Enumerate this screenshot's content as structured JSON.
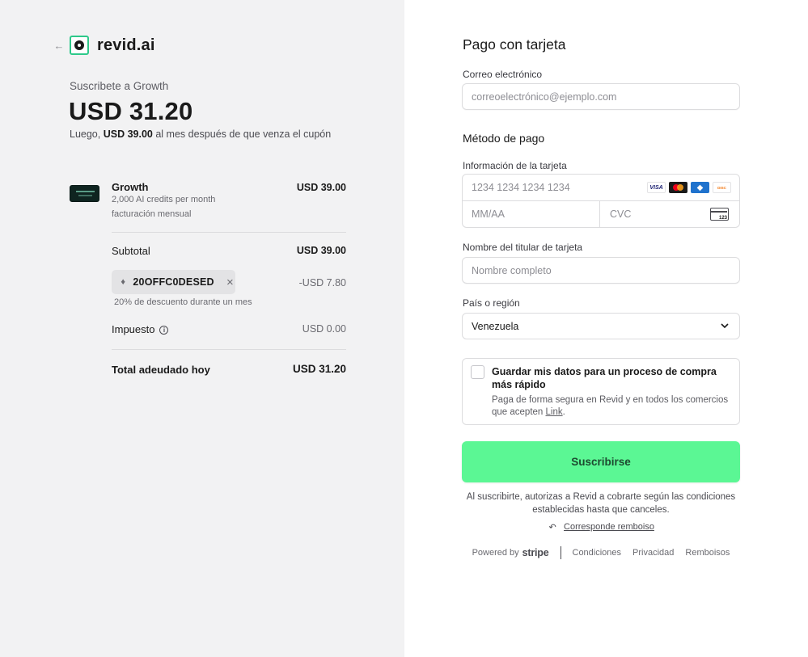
{
  "brand": {
    "name": "revid.ai",
    "back_icon": "arrow-left-icon",
    "logo_icon": "eye-logo-icon",
    "accent": "#2ec98a"
  },
  "summary": {
    "subscribe_label": "Suscribete a Growth",
    "amount": "USD 31.20",
    "later_prefix": "Luego,",
    "later_amount": "USD 39.00",
    "later_suffix": "al mes después de que venza el cupón"
  },
  "line_item": {
    "name": "Growth",
    "description": "2,000 AI credits per month",
    "billing": "facturación mensual",
    "price": "USD 39.00"
  },
  "totals": {
    "subtotal_label": "Subtotal",
    "subtotal_value": "USD 39.00",
    "coupon_code": "20OFFC0DESED",
    "coupon_discount": "-USD 7.80",
    "coupon_note": "20% de descuento durante un mes",
    "tax_label": "Impuesto",
    "tax_value": "USD 0.00",
    "total_label": "Total adeudado hoy",
    "total_value": "USD 31.20"
  },
  "form": {
    "title": "Pago con tarjeta",
    "email_label": "Correo electrónico",
    "email_placeholder": "correoelectrónico@ejemplo.com",
    "payment_method_title": "Método de pago",
    "card_info_label": "Información de la tarjeta",
    "card_number_placeholder": "1234 1234 1234 1234",
    "card_exp_placeholder": "MM/AA",
    "card_cvc_placeholder": "CVC",
    "card_brands": [
      "VISA",
      "mastercard",
      "amex",
      "discover"
    ],
    "cvc_icon_text": "123",
    "cardholder_label": "Nombre del titular de tarjeta",
    "cardholder_placeholder": "Nombre completo",
    "country_label": "País o región",
    "country_value": "Venezuela",
    "save_title": "Guardar mis datos para un proceso de compra más rápido",
    "save_desc_prefix": "Paga de forma segura en Revid y en todos los comercios que acepten",
    "save_desc_link": "Link",
    "save_desc_suffix": ".",
    "subscribe_button": "Suscribirse",
    "subscribe_color": "#5bf794"
  },
  "legal": {
    "terms": "Al suscribirte, autorizas a Revid a cobrarte según las condiciones establecidas hasta que canceles.",
    "refund_link": "Corresponde remboiso"
  },
  "footer": {
    "powered_by": "Powered by",
    "stripe": "stripe",
    "links": [
      "Condiciones",
      "Privacidad",
      "Remboisos"
    ]
  }
}
